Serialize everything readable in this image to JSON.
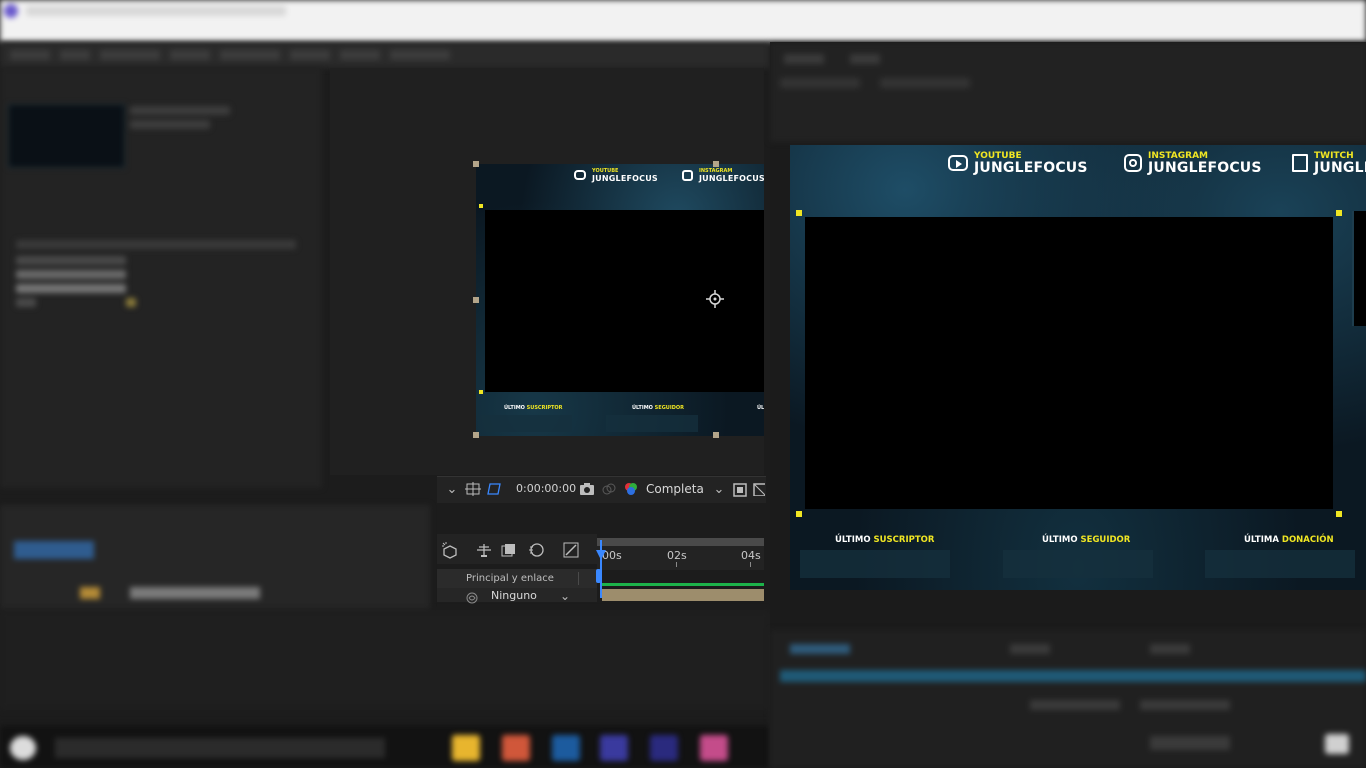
{
  "viewer": {
    "timecode": "0:00:00:00",
    "resolution": "Completa"
  },
  "timeline": {
    "ruler_labels": [
      "00s",
      "02s",
      "04s"
    ],
    "column_header": "Principal y enlace",
    "parent_value": "Ninguno"
  },
  "overlay": {
    "socials": [
      {
        "icon": "youtube-icon",
        "platform": "YOUTUBE",
        "handle": "JUNGLEFOCUS"
      },
      {
        "icon": "instagram-icon",
        "platform": "INSTAGRAM",
        "handle": "JUNGLEFOCUS"
      },
      {
        "icon": "twitch-icon",
        "platform": "TWITCH",
        "handle": "JUNGLE"
      }
    ],
    "labels": [
      {
        "prefix": "ÚLTIMO",
        "highlight": "SUSCRIPTOR"
      },
      {
        "prefix": "ÚLTIMO",
        "highlight": "SEGUIDOR"
      },
      {
        "prefix": "ÚLTIMA",
        "highlight": "DONACIÓN"
      }
    ],
    "small_trailing": "ÚL"
  },
  "colors": {
    "accent_yellow": "#f0e623",
    "playhead_blue": "#3a88ff",
    "timeline_green": "#1db34a",
    "panel_bg": "#1c1c1c"
  }
}
